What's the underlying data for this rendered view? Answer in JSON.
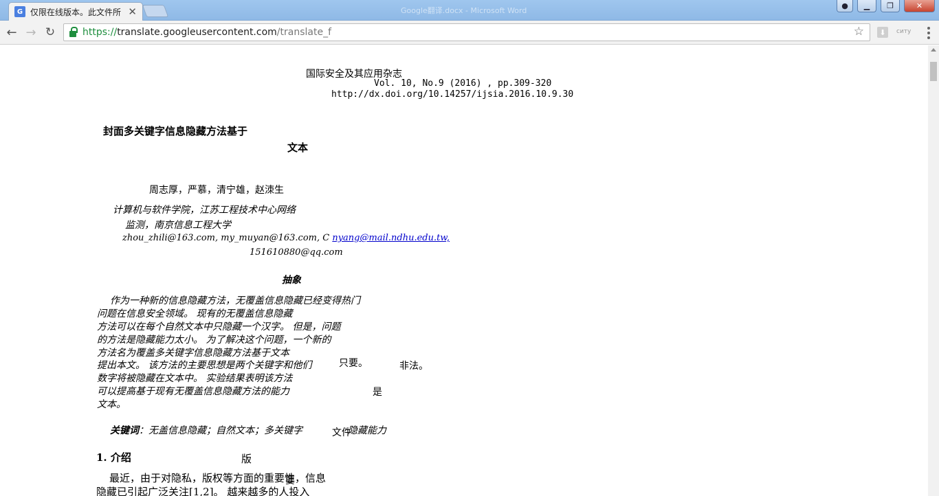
{
  "browser": {
    "tab": {
      "favicon": "G",
      "title": "仅限在线版本。此文件所",
      "close": "✕"
    },
    "window_caption": "Google翻译.docx - Microsoft Word",
    "address": {
      "secure": "https://",
      "host": "translate.googleusercontent.com",
      "path": "/translate_f"
    },
    "icons": {
      "back": "back-arrow-icon",
      "forward": "forward-arrow-icon",
      "reload": "reload-icon",
      "bookmark": "star-icon",
      "menu": "kebab-menu-icon"
    },
    "ext_label": "ситу"
  },
  "doc": {
    "journal": "国际安全及其应用杂志",
    "volume": "Vol. 10, No.9 (2016) , pp.309-320",
    "doi": "http://dx.doi.org/10.14257/ijsia.2016.10.9.30",
    "title_line1": "封面多关键字信息隐藏方法基于",
    "title_line2": "文本",
    "authors": "周志厚，严慕，清宁雄，赵洓生",
    "affiliation_line1": "计算机与软件学院，江苏工程技术中心网络",
    "affiliation_line2": "监测，南京信息工程大学",
    "emails_prefix": "zhou_zhili@163.com, my_muyan@163.com, C ",
    "emails_link": "nyang@mail.ndhu.edu.tw,",
    "email_line2": "151610880@qq.com",
    "abstract_heading": "抽象",
    "abstract_lines": [
      "作为一种新的信息隐藏方法，无覆盖信息隐藏已经变得热门",
      "问题在信息安全领域。 现有的无覆盖信息隐藏",
      "方法可以在每个自然文本中只隐藏一个汉字。 但是，问题",
      "的方法是隐藏能力太小。 为了解决这个问题，一个新的",
      "方法名为覆盖多关键字信息隐藏方法基于文本",
      "提出本文。 该方法的主要思想是两个关键字和他们",
      "数字将被隐藏在文本中。 实验结果表明该方法",
      "可以提高基于现有无覆盖信息隐藏方法的能力",
      "文本。"
    ],
    "abstract_overlay_1": "只要。",
    "abstract_overlay_2": "非法。",
    "abstract_overlay_3": "是",
    "keywords_label": "关键词",
    "keywords_sep": "：",
    "keywords_text": "无盖信息隐藏；自然文本；多关键字",
    "keywords_overlay_1": "文件",
    "keywords_overlay_2": "隐藏能力",
    "section_heading": "1. 介绍",
    "section_overlay": "版",
    "intro_line1": "最近，由于对隐私，版权等方面的重要性，信息",
    "intro_overlay": "要",
    "intro_line2": "隐藏已引起广泛关注[1,2]。 越来越多的人投入"
  }
}
